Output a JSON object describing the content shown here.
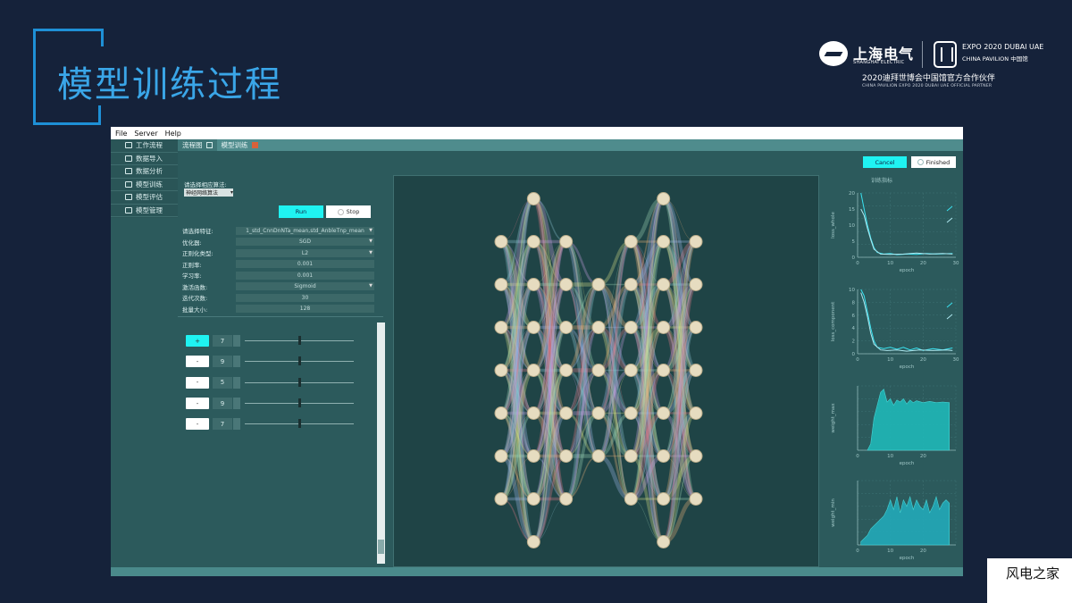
{
  "slide": {
    "title": "模型训练过程",
    "logo_sse": "上海电气",
    "logo_sse_en": "SHANGHAI ELECTRIC",
    "logo_expo": "EXPO 2020 DUBAI UAE",
    "logo_expo2": "CHINA PAVILION 中国馆",
    "logo_partner": "2020迪拜世博会中国馆官方合作伙伴",
    "logo_partner_en": "CHINA PAVILION EXPO 2020 DUBAI UAE OFFICIAL PARTNER",
    "footer": "风电之家"
  },
  "menu": [
    "File",
    "Server",
    "Help"
  ],
  "sidebar": [
    {
      "label": "工作流程",
      "icon": "workflow-icon"
    },
    {
      "label": "数据导入",
      "icon": "eye-icon"
    },
    {
      "label": "数据分析",
      "icon": "chart-icon"
    },
    {
      "label": "模型训练",
      "icon": "network-icon"
    },
    {
      "label": "模型评估",
      "icon": "evaluate-icon"
    },
    {
      "label": "模型管理",
      "icon": "manage-icon"
    }
  ],
  "tabs": [
    {
      "label": "流程图",
      "active": true
    },
    {
      "label": "模型训练",
      "active": false
    }
  ],
  "toolbar": {
    "cancel": "Cancel",
    "finished": "Finished",
    "run": "Run",
    "stop": "Stop"
  },
  "config": {
    "algo_label": "请选择相应算法:",
    "algo_value": "神经网络算法",
    "params": [
      {
        "label": "请选择特征:",
        "value": "1_std_CnnDnNTa_mean,std_AnbleTnp_mean",
        "dropdown": true
      },
      {
        "label": "优化器:",
        "value": "SGD",
        "dropdown": true
      },
      {
        "label": "正则化类型:",
        "value": "L2",
        "dropdown": true
      },
      {
        "label": "正则率:",
        "value": "0.001",
        "dropdown": false
      },
      {
        "label": "学习率:",
        "value": "0.001",
        "dropdown": false
      },
      {
        "label": "激活函数:",
        "value": "Sigmoid",
        "dropdown": true
      },
      {
        "label": "迭代次数:",
        "value": "30",
        "dropdown": false
      },
      {
        "label": "批量大小:",
        "value": "128",
        "dropdown": false
      }
    ],
    "layers": [
      {
        "btn": "+",
        "value": "7",
        "active": true
      },
      {
        "btn": "-",
        "value": "9",
        "active": false
      },
      {
        "btn": "-",
        "value": "5",
        "active": false
      },
      {
        "btn": "-",
        "value": "9",
        "active": false
      },
      {
        "btn": "-",
        "value": "7",
        "active": false
      }
    ]
  },
  "network": {
    "layers": [
      7,
      9,
      7,
      5,
      7,
      9,
      7
    ]
  },
  "colors": {
    "accent": "#1ff3f2",
    "panel": "#2c5a5c",
    "title": "#3aa6e8"
  },
  "chart_data": [
    {
      "type": "line",
      "title": "训练指标",
      "xlabel": "epoch",
      "ylabel": "loss_whole",
      "xlim": [
        0,
        30
      ],
      "ylim": [
        0,
        20
      ],
      "yticks": [
        0,
        5,
        10,
        15,
        20
      ],
      "xticks": [
        0,
        10,
        20,
        30
      ],
      "series": [
        {
          "values": [
            [
              1,
              20
            ],
            [
              2,
              15
            ],
            [
              3,
              10
            ],
            [
              4,
              6
            ],
            [
              5,
              3
            ],
            [
              6,
              1.5
            ],
            [
              8,
              1
            ],
            [
              10,
              1.2
            ],
            [
              12,
              0.8
            ],
            [
              15,
              1
            ],
            [
              18,
              0.9
            ],
            [
              21,
              1.2
            ],
            [
              24,
              1
            ],
            [
              27,
              1.1
            ],
            [
              29,
              1.2
            ]
          ]
        },
        {
          "values": [
            [
              1,
              15
            ],
            [
              2,
              13
            ],
            [
              3,
              9
            ],
            [
              4,
              5.5
            ],
            [
              5,
              2.5
            ],
            [
              7,
              1
            ],
            [
              10,
              0.9
            ],
            [
              14,
              1
            ],
            [
              18,
              1.3
            ],
            [
              22,
              1
            ],
            [
              26,
              1.2
            ],
            [
              29,
              1
            ]
          ]
        }
      ]
    },
    {
      "type": "line",
      "xlabel": "epoch",
      "ylabel": "loss_component",
      "xlim": [
        0,
        30
      ],
      "ylim": [
        0,
        10
      ],
      "yticks": [
        0,
        2,
        4,
        6,
        8,
        10
      ],
      "xticks": [
        0,
        10,
        20,
        30
      ],
      "series": [
        {
          "values": [
            [
              1,
              10
            ],
            [
              2,
              9
            ],
            [
              3,
              6.5
            ],
            [
              4,
              4
            ],
            [
              5,
              2
            ],
            [
              6,
              1
            ],
            [
              8,
              0.8
            ],
            [
              10,
              1
            ],
            [
              12,
              0.7
            ],
            [
              14,
              1
            ],
            [
              16,
              0.6
            ],
            [
              18,
              0.9
            ],
            [
              20,
              0.5
            ],
            [
              23,
              0.8
            ],
            [
              26,
              0.6
            ],
            [
              29,
              0.9
            ]
          ]
        },
        {
          "values": [
            [
              1,
              9.5
            ],
            [
              2,
              8
            ],
            [
              3,
              5.8
            ],
            [
              4,
              3.2
            ],
            [
              5,
              1.5
            ],
            [
              7,
              0.6
            ],
            [
              9,
              0.5
            ],
            [
              12,
              0.6
            ],
            [
              15,
              0.4
            ],
            [
              19,
              0.6
            ],
            [
              23,
              0.5
            ],
            [
              27,
              0.6
            ],
            [
              29,
              0.5
            ]
          ]
        }
      ]
    },
    {
      "type": "area",
      "xlabel": "epoch",
      "ylabel": "weight_max",
      "xlim": [
        0,
        30
      ],
      "ylim": [
        0,
        1
      ],
      "xticks": [
        0,
        10,
        20
      ],
      "series": [
        {
          "values": [
            [
              3,
              0
            ],
            [
              4,
              0.1
            ],
            [
              5,
              0.5
            ],
            [
              6,
              0.7
            ],
            [
              7,
              0.9
            ],
            [
              8,
              0.95
            ],
            [
              9,
              0.75
            ],
            [
              10,
              0.8
            ],
            [
              11,
              0.7
            ],
            [
              12,
              0.78
            ],
            [
              13,
              0.75
            ],
            [
              14,
              0.8
            ],
            [
              15,
              0.72
            ],
            [
              16,
              0.78
            ],
            [
              17,
              0.74
            ],
            [
              18,
              0.77
            ],
            [
              20,
              0.74
            ],
            [
              22,
              0.76
            ],
            [
              24,
              0.74
            ],
            [
              26,
              0.75
            ],
            [
              28,
              0.74
            ]
          ]
        }
      ]
    },
    {
      "type": "area",
      "xlabel": "epoch",
      "ylabel": "weight_min",
      "xlim": [
        0,
        30
      ],
      "ylim": [
        0,
        1
      ],
      "xticks": [
        0,
        10,
        20
      ],
      "series": [
        {
          "values": [
            [
              1,
              0.05
            ],
            [
              2,
              0.1
            ],
            [
              3,
              0.15
            ],
            [
              4,
              0.25
            ],
            [
              5,
              0.3
            ],
            [
              6,
              0.35
            ],
            [
              7,
              0.4
            ],
            [
              8,
              0.45
            ],
            [
              9,
              0.55
            ],
            [
              10,
              0.7
            ],
            [
              11,
              0.55
            ],
            [
              12,
              0.75
            ],
            [
              13,
              0.5
            ],
            [
              14,
              0.7
            ],
            [
              15,
              0.6
            ],
            [
              16,
              0.75
            ],
            [
              17,
              0.55
            ],
            [
              18,
              0.7
            ],
            [
              19,
              0.6
            ],
            [
              20,
              0.55
            ],
            [
              21,
              0.7
            ],
            [
              22,
              0.5
            ],
            [
              23,
              0.6
            ],
            [
              24,
              0.75
            ],
            [
              25,
              0.55
            ],
            [
              26,
              0.65
            ],
            [
              27,
              0.7
            ],
            [
              28,
              0.65
            ]
          ]
        }
      ]
    }
  ]
}
